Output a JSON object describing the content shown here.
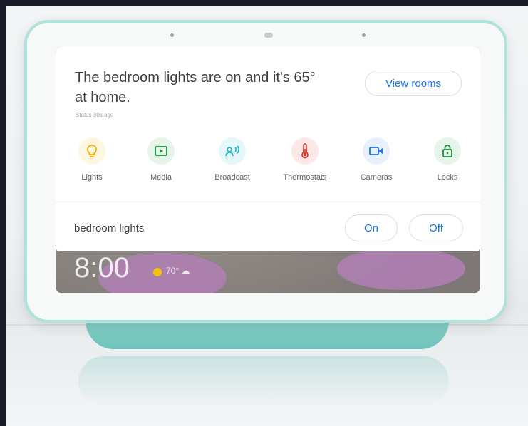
{
  "header": {
    "headline": "The bedroom lights are on and it's 65° at home.",
    "status": "Status 30s ago",
    "view_rooms_label": "View rooms"
  },
  "categories": [
    {
      "label": "Lights",
      "icon": "lightbulb-icon",
      "color": "#f9ab00",
      "bg": "#fef7e0"
    },
    {
      "label": "Media",
      "icon": "media-play-icon",
      "color": "#1e8e3e",
      "bg": "#e6f4ea"
    },
    {
      "label": "Broadcast",
      "icon": "broadcast-icon",
      "color": "#12b5cb",
      "bg": "#e4f7fb"
    },
    {
      "label": "Thermostats",
      "icon": "thermometer-icon",
      "color": "#d93025",
      "bg": "#fce8e6"
    },
    {
      "label": "Cameras",
      "icon": "camera-icon",
      "color": "#1a73e8",
      "bg": "#e8f0fe"
    },
    {
      "label": "Locks",
      "icon": "lock-icon",
      "color": "#1e8e3e",
      "bg": "#e6f4ea"
    }
  ],
  "device_control": {
    "label": "bedroom lights",
    "on_label": "On",
    "off_label": "Off"
  },
  "ambient": {
    "time": "8:00",
    "weather": "70° ☁"
  },
  "colors": {
    "accent": "#1a73e8",
    "device_shell": "#aee2da"
  }
}
